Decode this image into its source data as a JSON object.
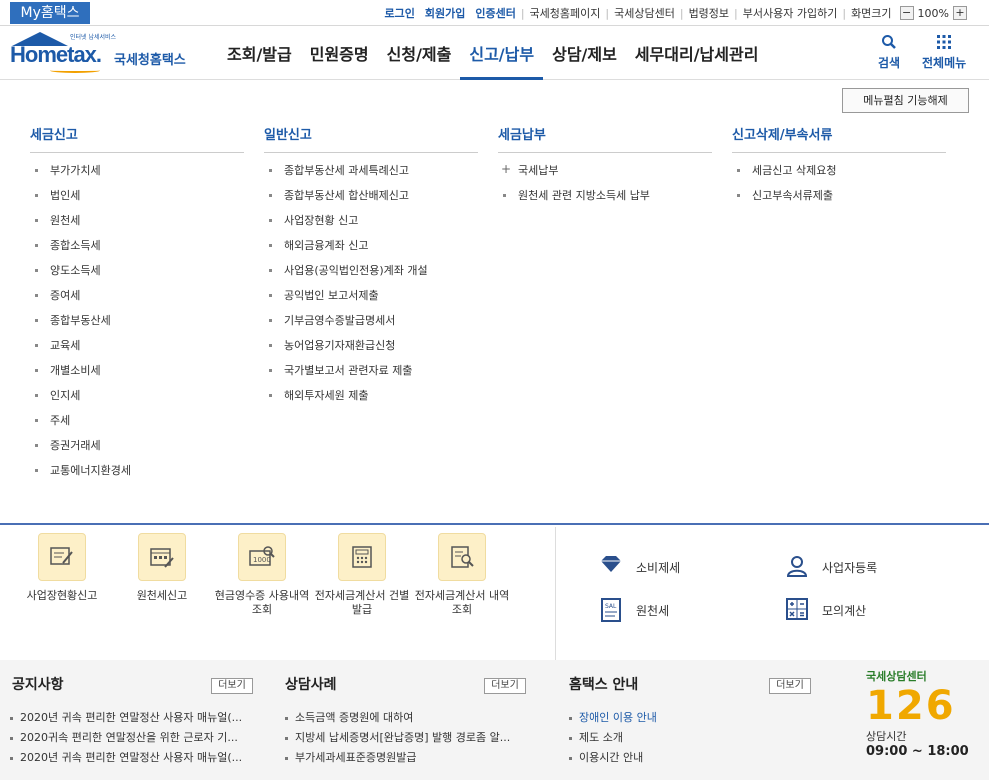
{
  "topbar": {
    "myhome": "My홈택스",
    "bold_links": [
      "로그인",
      "회원가입",
      "인증센터"
    ],
    "plain_links": [
      "국세청홈페이지",
      "국세상담센터",
      "법령정보",
      "부서사용자 가입하기",
      "화면크기"
    ],
    "zoom_minus": "−",
    "zoom_value": "100%",
    "zoom_plus": "+"
  },
  "header": {
    "logo_tiny": "인터넷 납세서비스",
    "logo_word": "Hometax.",
    "logo_kr": "국세청홈택스",
    "gnb": [
      "조회/발급",
      "민원증명",
      "신청/제출",
      "신고/납부",
      "상담/제보",
      "세무대리/납세관리"
    ],
    "active_index": 3,
    "search_label": "검색",
    "allmenu_label": "전체메뉴"
  },
  "menupanel": {
    "collapse_label": "메뉴펼침 기능해제",
    "columns": [
      {
        "title": "세금신고",
        "items": [
          "부가가치세",
          "법인세",
          "원천세",
          "종합소득세",
          "양도소득세",
          "증여세",
          "종합부동산세",
          "교육세",
          "개별소비세",
          "인지세",
          "주세",
          "증권거래세",
          "교통에너지환경세"
        ]
      },
      {
        "title": "일반신고",
        "items": [
          "종합부동산세 과세특례신고",
          "종합부동산세 합산배제신고",
          "사업장현황 신고",
          "해외금융계좌 신고",
          "사업용(공익법인전용)계좌 개설",
          "공익법인 보고서제출",
          "기부금영수증발급명세서",
          "농어업용기자재환급신청",
          "국가별보고서 관련자료 제출",
          "해외투자세원 제출"
        ]
      },
      {
        "title": "세금납부",
        "items": [
          "국세납부",
          "원천세 관련 지방소득세 납부"
        ]
      },
      {
        "title": "신고삭제/부속서류",
        "items": [
          "세금신고 삭제요청",
          "신고부속서류제출"
        ]
      }
    ]
  },
  "shortcuts": [
    {
      "label": "사업장현황신고",
      "icon": "form-pen-icon"
    },
    {
      "label": "원천세신고",
      "icon": "calendar-pen-icon"
    },
    {
      "label": "현금영수증 사용내역조회",
      "icon": "receipt-search-icon"
    },
    {
      "label": "전자세금계산서 건별발급",
      "icon": "calculator-doc-icon"
    },
    {
      "label": "전자세금계산서 내역조회",
      "icon": "doc-search-icon"
    }
  ],
  "right_items": [
    {
      "label": "소비제세",
      "icon": "diamond-icon"
    },
    {
      "label": "사업자등록",
      "icon": "person-icon"
    },
    {
      "label": "원천세",
      "icon": "salary-doc-icon"
    },
    {
      "label": "모의계산",
      "icon": "calculator-icon"
    }
  ],
  "bottom": {
    "more_label": "더보기",
    "notices": {
      "title": "공지사항",
      "items": [
        "2020년 귀속 편리한 연말정산 사용자 매뉴얼(...",
        "2020귀속 편리한 연말정산을 위한 근로자 기...",
        "2020년 귀속 편리한 연말정산 사용자 매뉴얼(..."
      ]
    },
    "cases": {
      "title": "상담사례",
      "items": [
        "소득금액 증명원에 대하여",
        "지방세 납세증명서[완납증명] 발행 경로좀 알...",
        "부가세과세표준증명원발급"
      ]
    },
    "guide": {
      "title": "홈택스 안내",
      "items": [
        "장애인 이용 안내",
        "제도 소개",
        "이용시간 안내"
      ]
    },
    "center": {
      "title": "국세상담센터",
      "num_a": "1",
      "num_b": "2",
      "num_c": "6",
      "hours_label": "상담시간",
      "hours": "09:00 ~ 18:00"
    }
  },
  "colors": {
    "brand": "#1d5aa8",
    "accent": "#f0a800",
    "tile": "#fdf0c8"
  }
}
